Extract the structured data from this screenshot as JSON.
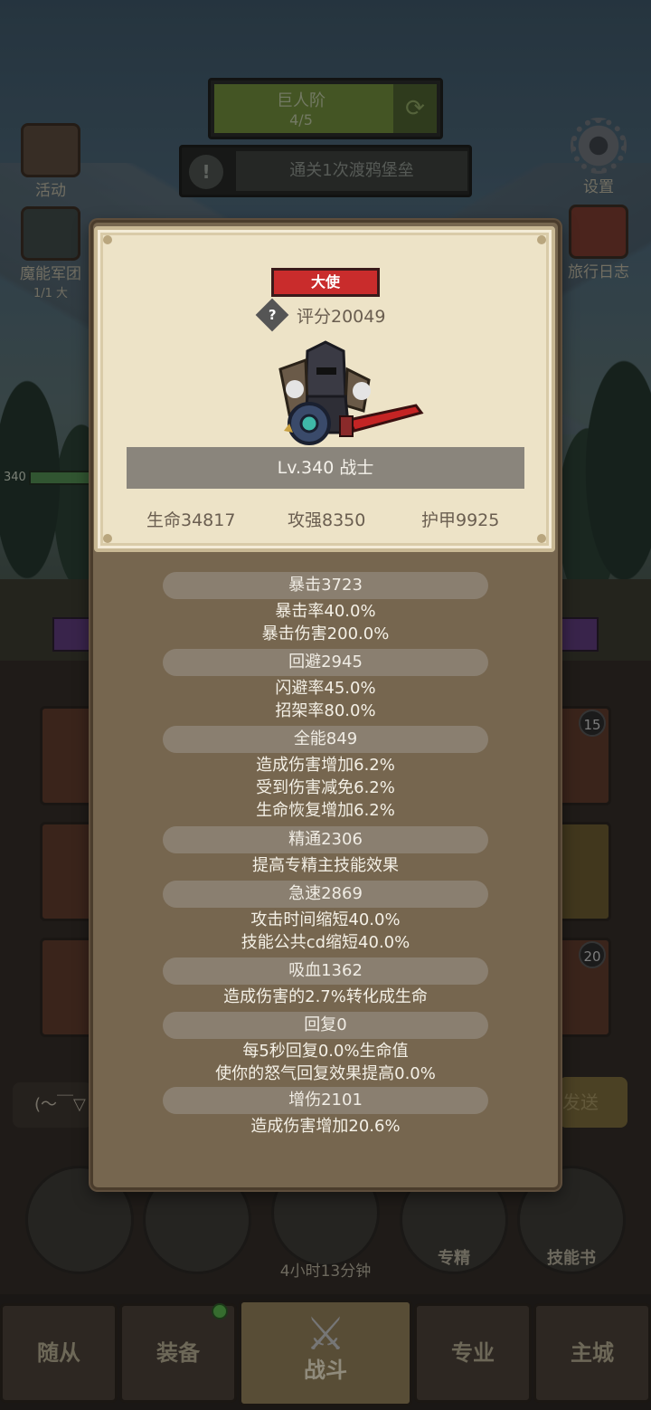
{
  "background": {
    "quest": {
      "name": "巨人阶",
      "progress": "4/5"
    },
    "task": {
      "text": "通关1次渡鸦堡垒"
    },
    "left_buttons": [
      {
        "label": "活动"
      },
      {
        "label": "魔能军团",
        "sub": "1/1 大"
      }
    ],
    "right_buttons": [
      {
        "label": "设置"
      },
      {
        "label": "旅行日志"
      }
    ],
    "unit_level": "340",
    "card_badges": [
      "15",
      "20"
    ],
    "chat_placeholder": "(～￣▽",
    "send_label": "发送",
    "circle_buttons": [
      {
        "label": ""
      },
      {
        "label": ""
      },
      {
        "label": ""
      },
      {
        "label": "专精"
      },
      {
        "label": "技能书"
      }
    ],
    "timer": "4小时13分钟",
    "tabs": [
      {
        "label": "随从"
      },
      {
        "label": "装备"
      },
      {
        "label": "战斗"
      },
      {
        "label": "专业"
      },
      {
        "label": "主城"
      }
    ]
  },
  "hero": {
    "rank": "大使",
    "score": "评分20049",
    "level_class": "Lv.340 战士",
    "hp": "生命34817",
    "attack": "攻强8350",
    "armor": "护甲9925"
  },
  "stats": {
    "crit": {
      "head": "暴击3723",
      "lines": [
        "暴击率40.0%",
        "暴击伤害200.0%"
      ]
    },
    "dodge": {
      "head": "回避2945",
      "lines": [
        "闪避率45.0%",
        "招架率80.0%"
      ]
    },
    "versatility": {
      "head": "全能849",
      "lines": [
        "造成伤害增加6.2%",
        "受到伤害减免6.2%",
        "生命恢复增加6.2%"
      ]
    },
    "mastery": {
      "head": "精通2306",
      "lines": [
        "提高专精主技能效果"
      ]
    },
    "haste": {
      "head": "急速2869",
      "lines": [
        "攻击时间缩短40.0%",
        "技能公共cd缩短40.0%"
      ]
    },
    "leech": {
      "head": "吸血1362",
      "lines": [
        "造成伤害的2.7%转化成生命"
      ]
    },
    "regen": {
      "head": "回复0",
      "lines": [
        "每5秒回复0.0%生命值",
        "使你的怒气回复效果提高0.0%"
      ]
    },
    "damage": {
      "head": "增伤2101",
      "lines": [
        "造成伤害增加20.6%"
      ]
    }
  },
  "colors": {
    "rank_badge": "#c92c2c",
    "modal_body": "#76664f",
    "card_parchment": "#ede3c7",
    "stat_head_bg": "#8a7f70"
  }
}
